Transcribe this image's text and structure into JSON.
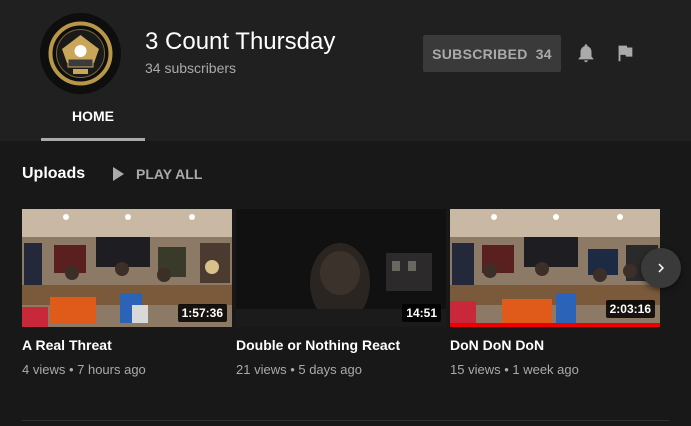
{
  "channel": {
    "name": "3 Count Thursday",
    "subscribers": "34 subscribers",
    "subscribe_label": "SUBSCRIBED",
    "subscribe_count": "34"
  },
  "tabs": [
    {
      "label": "HOME",
      "active": true
    }
  ],
  "uploads": {
    "title": "Uploads",
    "play_all": "PLAY ALL",
    "videos": [
      {
        "title": "A Real Threat",
        "meta": "4 views • 7 hours ago",
        "duration": "1:57:36",
        "watched": false
      },
      {
        "title": "Double or Nothing React",
        "meta": "21 views • 5 days ago",
        "duration": "14:51",
        "watched": false
      },
      {
        "title": "DoN DoN DoN",
        "meta": "15 views • 1 week ago",
        "duration": "2:03:16",
        "watched": true
      }
    ]
  },
  "colors": {
    "background": "#181818",
    "header": "#202020",
    "accent_red": "#e00"
  },
  "icons": [
    "bell-icon",
    "flag-icon",
    "play-icon",
    "chevron-right-icon"
  ]
}
